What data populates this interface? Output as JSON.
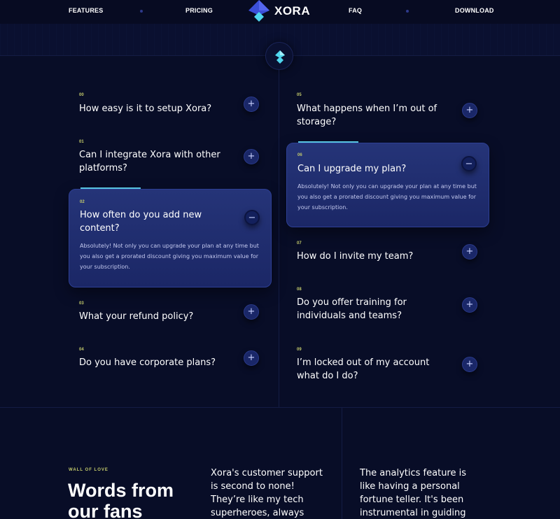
{
  "nav": {
    "features": "FEATURES",
    "pricing": "PRICING",
    "logo": "XORA",
    "faq": "FAQ",
    "download": "DOWNLOAD"
  },
  "icons": {
    "logo": "xora-logo-icon",
    "center": "xora-diamond-icon",
    "expand": "plus-icon",
    "collapse": "minus-icon"
  },
  "faq_left": [
    {
      "num": "00",
      "q": "How easy is it to setup Xora?",
      "btn": "+"
    },
    {
      "num": "01",
      "q": "Can I integrate Xora with other platforms?",
      "btn": "+"
    },
    {
      "num": "02",
      "q": "How often do you add new content?",
      "btn": "−",
      "a": "Absolutely! Not only you can upgrade your plan at any time but you also get a prorated discount giving you maximum value for your subscription."
    },
    {
      "num": "03",
      "q": "What your refund policy?",
      "btn": "+"
    },
    {
      "num": "04",
      "q": "Do you have corporate plans?",
      "btn": "+"
    }
  ],
  "faq_right": [
    {
      "num": "05",
      "q": "What happens when I’m out of storage?",
      "btn": "+"
    },
    {
      "num": "06",
      "q": "Can I upgrade my plan?",
      "btn": "−",
      "a": "Absolutely! Not only you can upgrade your plan at any time but you also get a prorated discount giving you maximum value for your subscription."
    },
    {
      "num": "07",
      "q": "How do I invite my team?",
      "btn": "+"
    },
    {
      "num": "08",
      "q": "Do you offer training for individuals and teams?",
      "btn": "+"
    },
    {
      "num": "09",
      "q": "I’m locked out of my account what do I do?",
      "btn": "+"
    }
  ],
  "testimonials": {
    "kicker": "WALL OF LOVE",
    "heading": "Words from our fans",
    "quote1": "Xora's customer support is second to none! They’re like my tech superheroes, always",
    "quote2": "The analytics feature is like having a personal fortune teller. It's been instrumental in guiding"
  },
  "colors": {
    "background": "#080d27",
    "accent": "#5fd4f2",
    "number": "#c4cb6b",
    "open_card": "#253478"
  }
}
